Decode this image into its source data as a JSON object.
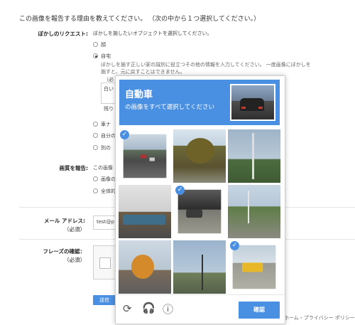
{
  "report": {
    "heading": "この画像を報告する理由を教えてください。 （次の中から１つ選択してください。）"
  },
  "blur_request": {
    "label": "ぼかしのリクエスト:",
    "instruction": "ぼかしを施したいオブジェクトを選択してください。",
    "options": [
      "顔",
      "自宅"
    ],
    "selected_note_line1": "ぼかしを施す正しい家の識別に役立つその他の情報を入力してください。 一度画像にぼかしを",
    "selected_note_line2": "施すと、元に戻すことはできません。",
    "paren_fragment": "（必",
    "textarea_fragment": "白い",
    "remaining_fragment": "残り",
    "more_options": [
      "車ナ",
      "自分の",
      "別の"
    ]
  },
  "image_report": {
    "label": "画質を報告:",
    "text_fragment": "この画像",
    "options": [
      "画像の",
      "全体的"
    ]
  },
  "email": {
    "label_line1": "メール アドレス:",
    "label_line2": "（必須）",
    "value_fragment": "test@p"
  },
  "phrase": {
    "label_line1": "フレーズの確認：",
    "label_line2": "（必須）"
  },
  "send_label": "送信",
  "footer_text": "ホーム・プライバシー ポリシー",
  "captcha": {
    "title": "自動車",
    "subtitle": "の画像をすべて選択してください",
    "verify_label": "確認",
    "accent": "#4a90e2",
    "tiles": [
      {
        "name": "road-with-cars",
        "selected": true
      },
      {
        "name": "tree",
        "selected": false
      },
      {
        "name": "utility-pole",
        "selected": false
      },
      {
        "name": "storefront",
        "selected": false
      },
      {
        "name": "car-in-parking",
        "selected": true
      },
      {
        "name": "road-trees",
        "selected": false
      },
      {
        "name": "autumn-tree",
        "selected": false
      },
      {
        "name": "sky-pole",
        "selected": false
      },
      {
        "name": "yellow-taxi",
        "selected": true
      }
    ],
    "footer_icons": [
      "refresh-icon",
      "headphones-icon",
      "info-icon"
    ]
  }
}
